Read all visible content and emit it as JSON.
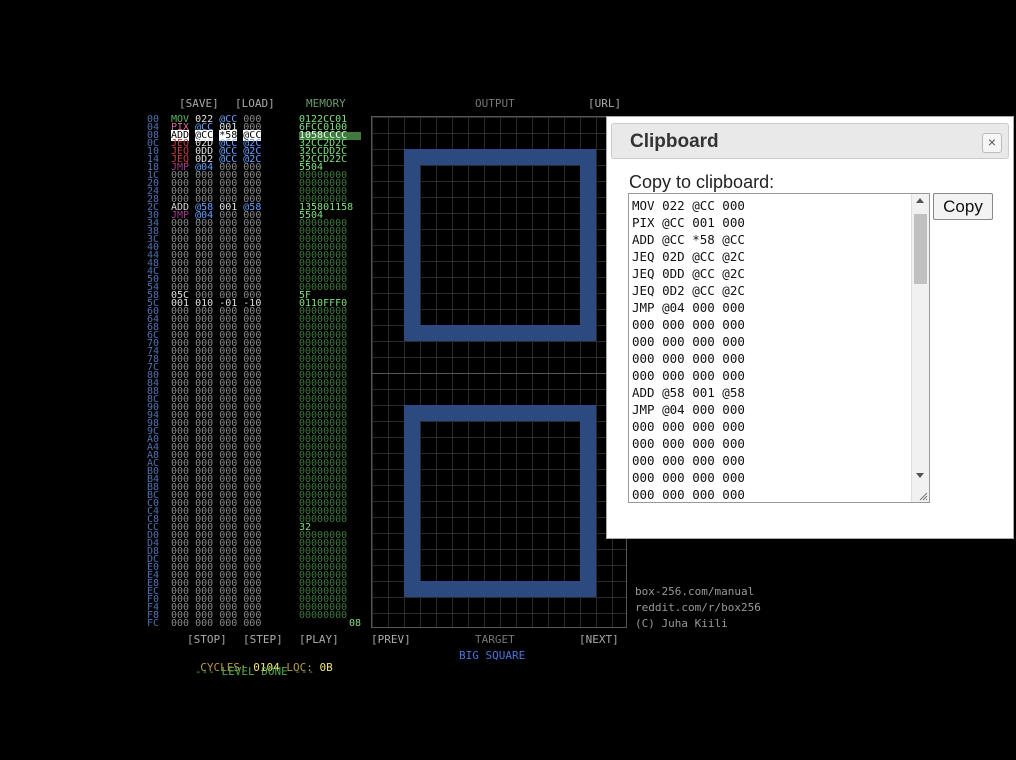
{
  "toolbar": {
    "save": "[SAVE]",
    "load": "[LOAD]",
    "memory": "MEMORY",
    "output": "OUTPUT",
    "url": "[URL]"
  },
  "row_labels": [
    "00",
    "04",
    "08",
    "0C",
    "10",
    "14",
    "18",
    "1C",
    "20",
    "24",
    "28",
    "2C",
    "30",
    "34",
    "38",
    "3C",
    "40",
    "44",
    "48",
    "4C",
    "50",
    "54",
    "58",
    "5C",
    "60",
    "64",
    "68",
    "6C",
    "70",
    "74",
    "78",
    "7C",
    "80",
    "84",
    "88",
    "8C",
    "90",
    "94",
    "98",
    "9C",
    "A0",
    "A4",
    "A8",
    "AC",
    "B0",
    "B4",
    "B8",
    "BC",
    "C0",
    "C4",
    "C8",
    "CC",
    "D0",
    "D4",
    "D8",
    "DC",
    "E0",
    "E4",
    "E8",
    "EC",
    "F0",
    "F4",
    "F8",
    "FC"
  ],
  "code_rows": [
    [
      "MOV",
      "022",
      "@CC",
      "000"
    ],
    [
      "PIX",
      "@CC",
      "001",
      "000"
    ],
    [
      "ADD",
      "@CC",
      "*58",
      "@CC"
    ],
    [
      "JEQ",
      "02D",
      "@CC",
      "@2C"
    ],
    [
      "JEQ",
      "0DD",
      "@CC",
      "@2C"
    ],
    [
      "JEQ",
      "0D2",
      "@CC",
      "@2C"
    ],
    [
      "JMP",
      "@04",
      "000",
      "000"
    ],
    [
      "000",
      "000",
      "000",
      "000"
    ],
    [
      "000",
      "000",
      "000",
      "000"
    ],
    [
      "000",
      "000",
      "000",
      "000"
    ],
    [
      "000",
      "000",
      "000",
      "000"
    ],
    [
      "ADD",
      "@58",
      "001",
      "@58"
    ],
    [
      "JMP",
      "@04",
      "000",
      "000"
    ],
    [
      "000",
      "000",
      "000",
      "000"
    ],
    [
      "000",
      "000",
      "000",
      "000"
    ],
    [
      "000",
      "000",
      "000",
      "000"
    ],
    [
      "000",
      "000",
      "000",
      "000"
    ],
    [
      "000",
      "000",
      "000",
      "000"
    ],
    [
      "000",
      "000",
      "000",
      "000"
    ],
    [
      "000",
      "000",
      "000",
      "000"
    ],
    [
      "000",
      "000",
      "000",
      "000"
    ],
    [
      "000",
      "000",
      "000",
      "000"
    ],
    [
      "05C",
      "000",
      "000",
      "000"
    ],
    [
      "001",
      "010",
      "-01",
      "-10"
    ]
  ],
  "memory_rows": [
    "0122CC01",
    "6FCC0100",
    "1058CCCC",
    "32CC2D2C",
    "32CCDD2C",
    "32CCD22C",
    "5504",
    "",
    "",
    "",
    "",
    "1358011 58",
    "5504",
    "",
    "",
    "",
    "",
    "",
    "",
    "",
    "",
    "",
    "5F",
    "0110FFF0"
  ],
  "memory_cc": "32",
  "memory_fc": "08",
  "controls": {
    "stop": "[STOP]",
    "step": "[STEP]",
    "play": "[PLAY]",
    "prev": "[PREV]",
    "target": "TARGET",
    "next": "[NEXT]"
  },
  "status": {
    "cycles_label": "CYCLES:",
    "cycles": "0104",
    "loc_label": "LOC:",
    "loc": "0B",
    "done": "--- LEVEL DONE ---"
  },
  "level_name": "BIG SQUARE",
  "links": [
    "box-256.com/manual",
    "reddit.com/r/box256",
    "(C) Juha Kiili"
  ],
  "dialog": {
    "title": "Clipboard",
    "close": "×",
    "label": "Copy to clipboard:",
    "copy_button": "Copy",
    "lines": [
      "MOV 022 @CC 000",
      "PIX @CC 001 000",
      "ADD @CC *58 @CC",
      "JEQ 02D @CC @2C",
      "JEQ 0DD @CC @2C",
      "JEQ 0D2 @CC @2C",
      "JMP @04 000 000",
      "000 000 000 000",
      "000 000 000 000",
      "000 000 000 000",
      "000 000 000 000",
      "ADD @58 001 @58",
      "JMP @04 000 000",
      "000 000 000 000",
      "000 000 000 000",
      "000 000 000 000",
      "000 000 000 000",
      "000 000 000 000"
    ]
  },
  "colors": {
    "accent": "#2c4a80",
    "memory": "#4fd84f",
    "rowlabel": "#4d73b3"
  }
}
